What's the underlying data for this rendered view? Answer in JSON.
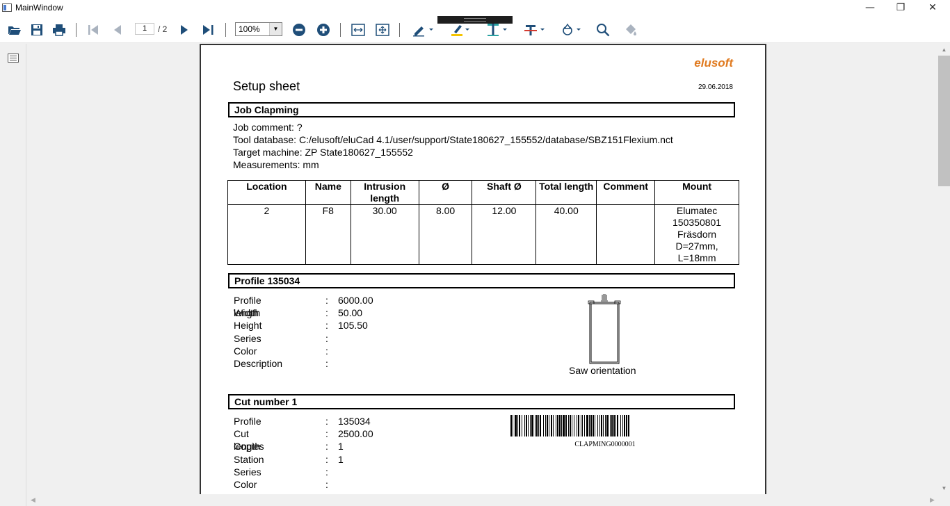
{
  "window": {
    "title": "MainWindow",
    "minimize_glyph": "—",
    "restore_glyph": "❐",
    "close_glyph": "✕"
  },
  "toolbar": {
    "current_page": "1",
    "page_total": "/ 2",
    "zoom": "100%",
    "icons": [
      "folder-open-icon",
      "save-icon",
      "print-icon",
      "first-page-icon",
      "previous-page-icon",
      "next-page-icon",
      "last-page-icon",
      "zoom-out-icon",
      "zoom-in-icon",
      "fit-width-icon",
      "fit-page-icon",
      "pen-icon",
      "highlighter-icon",
      "text-icon",
      "strikethrough-icon",
      "shapes-icon",
      "search-icon",
      "fill-icon"
    ]
  },
  "document": {
    "brand": "elusoft",
    "title": "Setup sheet",
    "date": "29.06.2018",
    "job_section": "Job Clapming",
    "job_lines": [
      "Job comment: ?",
      "Tool database: C:/elusoft/eluCad 4.1/user/support/State180627_155552/database/SBZ151Flexium.nct",
      "Target machine: ZP State180627_155552",
      "Measurements: mm"
    ],
    "tool_table": {
      "headers": [
        "Location",
        "Name",
        "Intrusion length",
        "Ø",
        "Shaft Ø",
        "Total length",
        "Comment",
        "Mount"
      ],
      "rows": [
        [
          "2",
          "F8",
          "30.00",
          "8.00",
          "12.00",
          "40.00",
          "",
          "Elumatec 150350801 Fräsdorn D=27mm, L=18mm"
        ]
      ]
    },
    "profile_section": "Profile 135034",
    "profile_fields": [
      {
        "key": "Profile length",
        "value": "6000.00"
      },
      {
        "key": "Width",
        "value": "50.00"
      },
      {
        "key": "Height",
        "value": "105.50"
      },
      {
        "key": "Series",
        "value": ""
      },
      {
        "key": "Color",
        "value": ""
      },
      {
        "key": "Description",
        "value": ""
      }
    ],
    "saw_label": "Saw orientation",
    "cut_section": "Cut number 1",
    "cut_fields": [
      {
        "key": "Profile",
        "value": "135034"
      },
      {
        "key": "Cut length",
        "value": "2500.00"
      },
      {
        "key": "Copies",
        "value": "1"
      },
      {
        "key": "Station",
        "value": "1"
      },
      {
        "key": "Series",
        "value": ""
      },
      {
        "key": "Color",
        "value": ""
      }
    ],
    "barcode_text": "CLAPMING0000001",
    "separator": ":"
  },
  "colors": {
    "brand": "#e07a1f",
    "toolbar_blue": "#1f4e79",
    "highlighter_yellow": "#f5c400",
    "teal": "#2aa3a3",
    "red": "#d43a2f"
  }
}
